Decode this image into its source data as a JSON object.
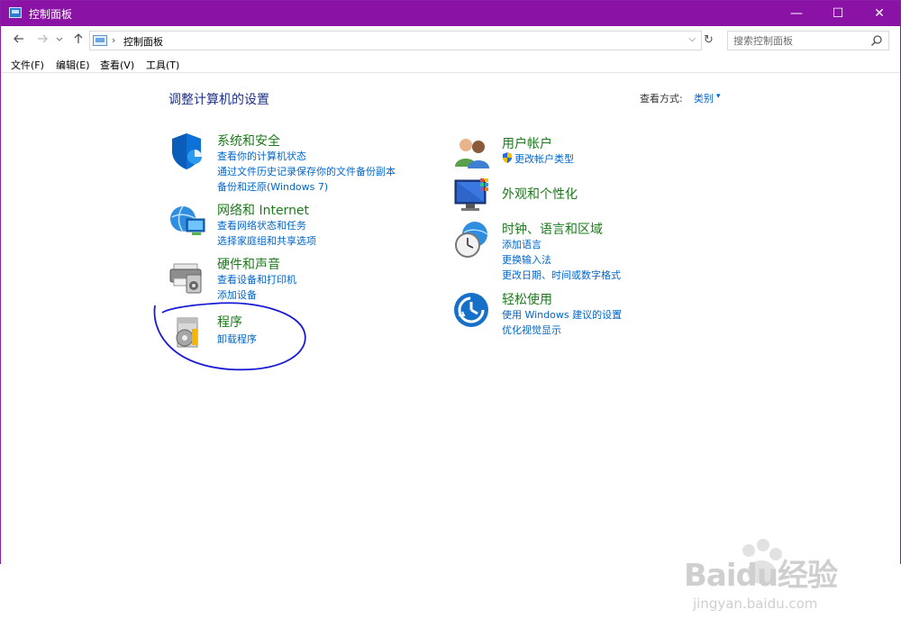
{
  "window": {
    "title": "控制面板",
    "controls": {
      "minimize": "—",
      "maximize": "☐",
      "close": "✕"
    }
  },
  "nav": {
    "back_icon": "arrow-left-icon",
    "forward_icon": "arrow-right-icon",
    "recent_icon": "chevron-down-icon",
    "up_icon": "arrow-up-icon"
  },
  "address": {
    "separator": "›",
    "path": "控制面板",
    "dropdown": "⌵",
    "refresh": "↻"
  },
  "search": {
    "placeholder": "搜索控制面板"
  },
  "menu": {
    "file": "文件(F)",
    "edit": "编辑(E)",
    "view": "查看(V)",
    "tools": "工具(T)"
  },
  "main": {
    "heading": "调整计算机的设置",
    "view_by_label": "查看方式:",
    "view_by_value": "类别",
    "view_by_caret": "▾"
  },
  "categories": {
    "system_security": {
      "title": "系统和安全",
      "icon": "shield-icon",
      "links": [
        "查看你的计算机状态",
        "通过文件历史记录保存你的文件备份副本",
        "备份和还原(Windows 7)"
      ]
    },
    "network": {
      "title": "网络和 Internet",
      "icon": "globe-network-icon",
      "links": [
        "查看网络状态和任务",
        "选择家庭组和共享选项"
      ]
    },
    "hardware": {
      "title": "硬件和声音",
      "icon": "printer-icon",
      "links": [
        "查看设备和打印机",
        "添加设备"
      ]
    },
    "programs": {
      "title": "程序",
      "icon": "programs-disc-icon",
      "links": [
        "卸载程序"
      ]
    },
    "user_accounts": {
      "title": "用户帐户",
      "icon": "users-icon",
      "links": [
        "更改帐户类型"
      ]
    },
    "appearance": {
      "title": "外观和个性化",
      "icon": "monitor-palette-icon",
      "links": []
    },
    "clock_region": {
      "title": "时钟、语言和区域",
      "icon": "clock-globe-icon",
      "links": [
        "添加语言",
        "更换输入法",
        "更改日期、时间或数字格式"
      ]
    },
    "ease_access": {
      "title": "轻松使用",
      "icon": "ease-of-access-icon",
      "links": [
        "使用 Windows 建议的设置",
        "优化视觉显示"
      ]
    }
  },
  "watermark": {
    "logo": "Baidu经验",
    "url": "jingyan.baidu.com"
  },
  "colors": {
    "titlebar": "#8a12a4",
    "category_title": "#1c7a1c",
    "link": "#0066cc",
    "heading": "#1e3287",
    "annotation": "#1a1ad6"
  }
}
